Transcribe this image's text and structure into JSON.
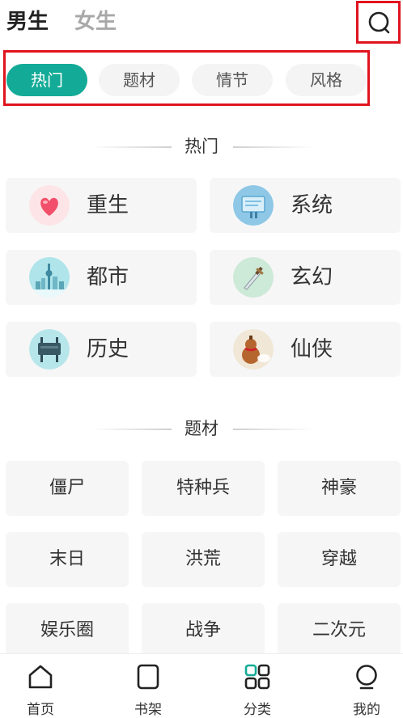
{
  "header": {
    "gender_tabs": [
      {
        "label": "男生",
        "active": true
      },
      {
        "label": "女生",
        "active": false
      }
    ],
    "search_icon": "search-icon"
  },
  "category_tabs": [
    {
      "label": "热门",
      "active": true
    },
    {
      "label": "题材",
      "active": false
    },
    {
      "label": "情节",
      "active": false
    },
    {
      "label": "风格",
      "active": false
    }
  ],
  "hot_section": {
    "title": "热门",
    "items": [
      {
        "label": "重生",
        "icon": "heart-icon"
      },
      {
        "label": "系统",
        "icon": "screen-icon"
      },
      {
        "label": "都市",
        "icon": "city-icon"
      },
      {
        "label": "玄幻",
        "icon": "sword-icon"
      },
      {
        "label": "历史",
        "icon": "bronze-vessel-icon"
      },
      {
        "label": "仙侠",
        "icon": "gourd-icon"
      }
    ]
  },
  "theme_section": {
    "title": "题材",
    "items": [
      "僵尸",
      "特种兵",
      "神豪",
      "末日",
      "洪荒",
      "穿越",
      "娱乐圈",
      "战争",
      "二次元"
    ]
  },
  "bottom_nav": [
    {
      "label": "首页",
      "icon": "home-icon"
    },
    {
      "label": "书架",
      "icon": "bookshelf-icon"
    },
    {
      "label": "分类",
      "icon": "category-icon",
      "active": true
    },
    {
      "label": "我的",
      "icon": "profile-icon"
    }
  ],
  "colors": {
    "accent": "#13ab97",
    "highlight_box": "#e0141e"
  }
}
